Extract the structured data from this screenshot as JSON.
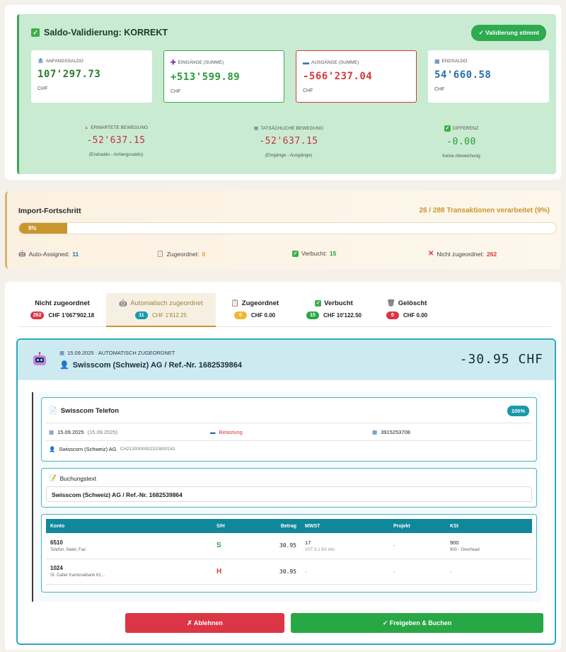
{
  "validation": {
    "title": "Saldo-Validierung: KORREKT",
    "badge": "✓ Validierung stimmt",
    "boxes": [
      {
        "label": "Anfangssaldo",
        "amount": "107'297.73",
        "currency": "CHF",
        "color": "#2a7a2f"
      },
      {
        "label": "Eingänge (Summe)",
        "amount": "+513'599.89",
        "currency": "CHF",
        "color": "#2a9a3a"
      },
      {
        "label": "Ausgänge (Summe)",
        "amount": "-566'237.04",
        "currency": "CHF",
        "color": "#d33b3b"
      },
      {
        "label": "Endsaldo",
        "amount": "54'660.58",
        "currency": "CHF",
        "color": "#2a6fa8"
      }
    ],
    "movements": [
      {
        "label": "Erwartete Bewegung",
        "amount": "-52'637.15",
        "sub": "(Endsaldo - Anfangssaldo)"
      },
      {
        "label": "Tatsächliche Bewegung",
        "amount": "-52'637.15",
        "sub": "(Eingänge - Ausgänge)"
      },
      {
        "label": "Differenz",
        "amount": "-0.00",
        "sub": "Keine Abweichung"
      }
    ]
  },
  "import": {
    "title": "Import-Fortschritt",
    "count": "26 / 288 Transaktionen verarbeitet (9%)",
    "progress_label": "9%",
    "progress": 0.09,
    "stats": [
      {
        "label": "Auto-Assigned:",
        "value": "11",
        "color": "#2a6fa8"
      },
      {
        "label": "Zugeordnet:",
        "value": "0",
        "color": "#e0a31b"
      },
      {
        "label": "Verbucht:",
        "value": "15",
        "color": "#2a9a3a"
      },
      {
        "label": "Nicht zugeordnet:",
        "value": "262",
        "color": "#d33b3b"
      }
    ]
  },
  "tabs": [
    {
      "label": "Nicht zugeordnet",
      "count": "262",
      "amount": "CHF 1'067'902.18",
      "pill_color": "#dc3545"
    },
    {
      "label": "Automatisch zugeordnet",
      "count": "11",
      "amount": "CHF 1'812.25",
      "pill_color": "#1a9aa8"
    },
    {
      "label": "Zugeordnet",
      "count": "0",
      "amount": "CHF 0.00",
      "pill_color": "#f2b632"
    },
    {
      "label": "Verbucht",
      "count": "15",
      "amount": "CHF 10'122.50",
      "pill_color": "#28a745"
    },
    {
      "label": "Gelöscht",
      "count": "0",
      "amount": "CHF 0.00",
      "pill_color": "#dc3545"
    }
  ],
  "transaction": {
    "date_line": "15.09.2025 · AUTOMATISCH ZUGEORDNET",
    "name": "Swisscom (Schweiz) AG / Ref.-Nr. 1682539864",
    "amount": "-30.95 CHF",
    "detail": {
      "title": "Swisscom Telefon",
      "badge": "100%",
      "date": "15.09.2025",
      "date_paren": "(15.09.2025)",
      "type": "Belastung",
      "ref": "3915253708",
      "party": "Swisscom (Schweiz) AG",
      "iban": "CH2130000002310800141"
    },
    "buchungstext_label": "Buchungstext",
    "buchungstext": "Swisscom (Schweiz) AG / Ref.-Nr.  1682539864",
    "table": {
      "headers": [
        "Konto",
        "S/H",
        "Betrag",
        "MWST",
        "Projekt",
        "KSt"
      ],
      "rows": [
        {
          "konto": "6510",
          "konto_sub": "Telefon, Natel, Fax",
          "sh": "S",
          "betrag": "30.95",
          "mwst": "17",
          "mwst_sub": "VST 8.1 BA inkl.",
          "projekt": "-",
          "kst": "900",
          "kst_sub": "900 - Overhead"
        },
        {
          "konto": "1024",
          "konto_sub": "St. Galler Kantonalbank 61…",
          "sh": "H",
          "betrag": "30.95",
          "mwst": "-",
          "mwst_sub": "",
          "projekt": "-",
          "kst": "-",
          "kst_sub": ""
        }
      ]
    },
    "reject_label": "✗ Ablehnen",
    "approve_label": "✓ Freigeben & Buchen"
  }
}
